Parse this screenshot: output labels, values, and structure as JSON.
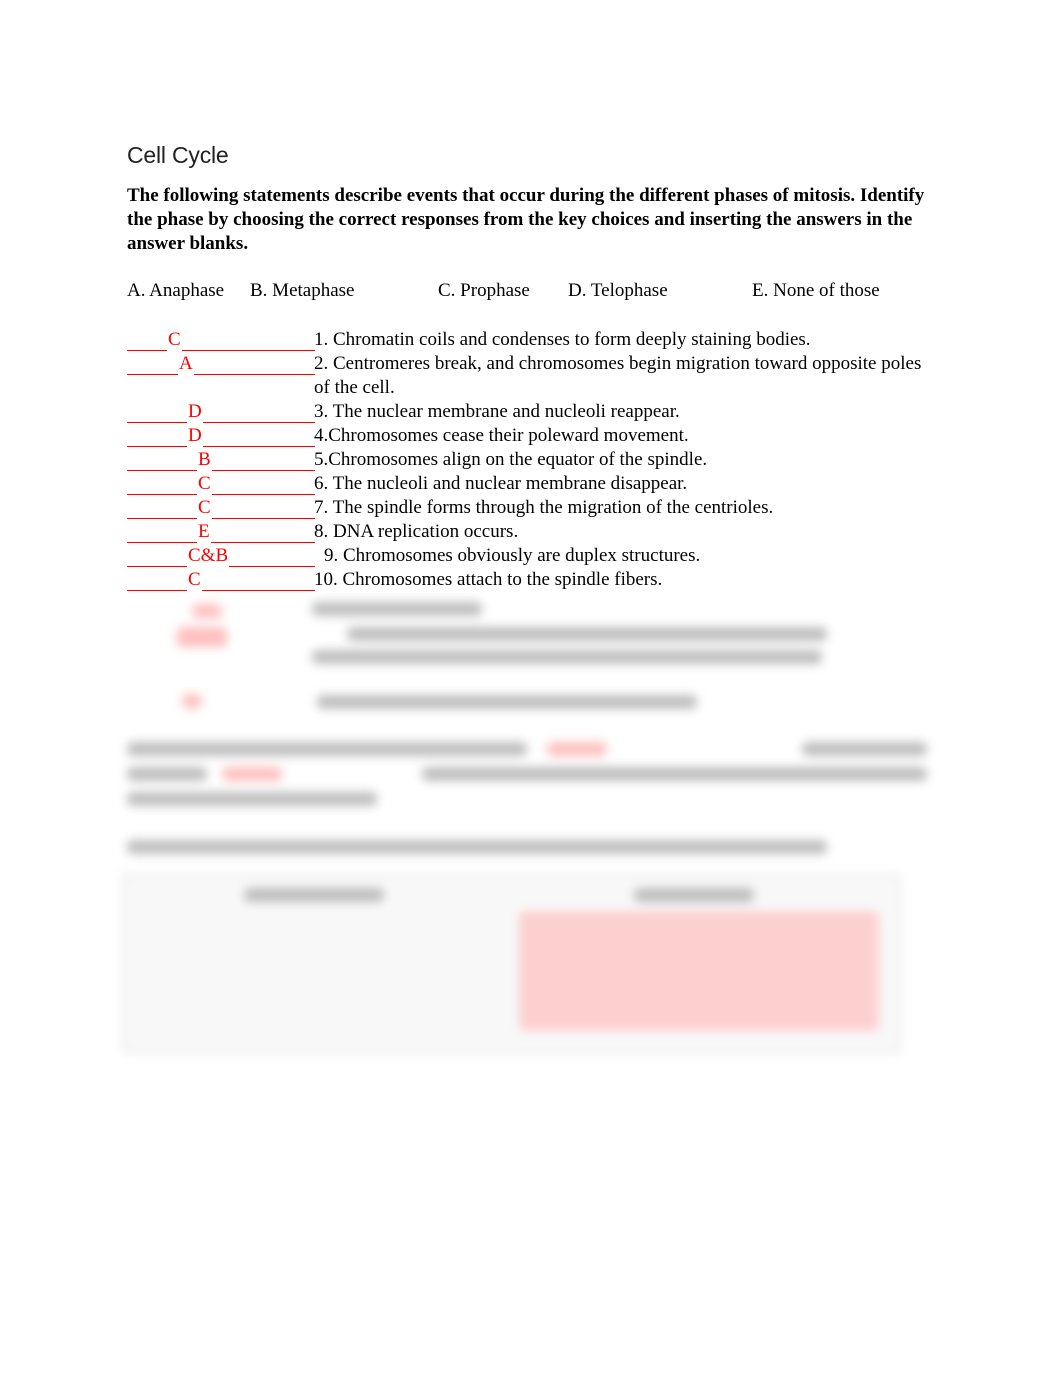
{
  "document": {
    "title": "Cell Cycle",
    "instructions": "The following statements describe events that occur during the different phases of mitosis. Identify the phase by choosing the correct responses from the key choices and inserting the answers in the answer blanks.",
    "key_choices": [
      {
        "label": "A. Anaphase"
      },
      {
        "label": "B.  Metaphase"
      },
      {
        "label": "C. Prophase"
      },
      {
        "label": "D. Telophase"
      },
      {
        "label": "E. None of those"
      }
    ],
    "items": [
      {
        "answer": "C",
        "statement": "1. Chromatin coils and condenses to form deeply staining bodies."
      },
      {
        "answer": "A",
        "statement": "2. Centromeres break, and chromosomes begin migration toward opposite poles of the cell."
      },
      {
        "answer": "D",
        "statement": "3. The nuclear membrane and nucleoli reappear."
      },
      {
        "answer": "D",
        "statement": "4.Chromosomes cease their poleward movement."
      },
      {
        "answer": "B",
        "statement": "5.Chromosomes align on the equator of the spindle."
      },
      {
        "answer": "C",
        "statement": "6. The nucleoli and nuclear membrane disappear."
      },
      {
        "answer": "C",
        "statement": "7. The spindle forms through the migration of the centrioles."
      },
      {
        "answer": "E",
        "statement": "8. DNA replication occurs."
      },
      {
        "answer": "C&B",
        "statement": "9. Chromosomes obviously are duplex structures."
      },
      {
        "answer": "C",
        "statement": "10. Chromosomes attach to the spindle fibers."
      }
    ],
    "answer_color": "#ff0000"
  }
}
